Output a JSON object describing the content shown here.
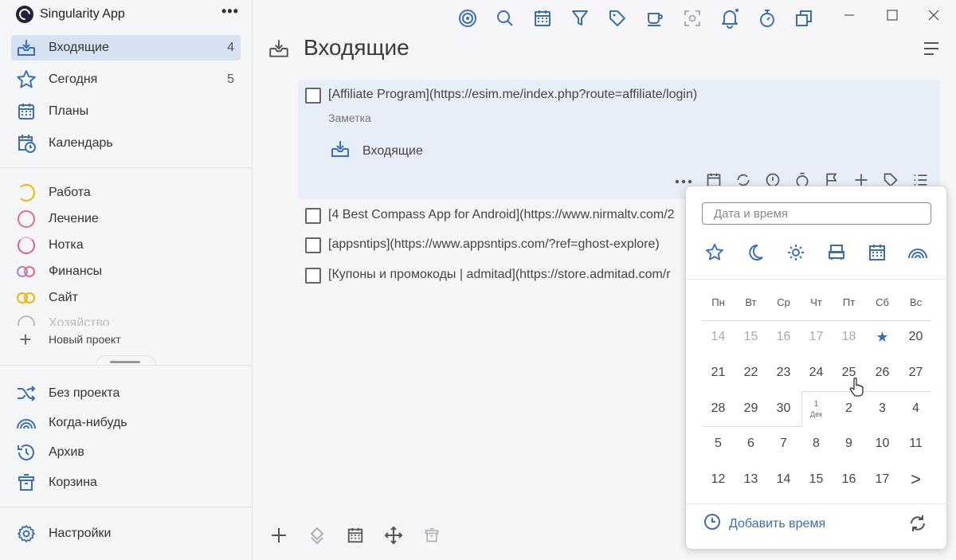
{
  "app": {
    "title": "Singularity App"
  },
  "sidebar": {
    "main_items": [
      {
        "label": "Входящие",
        "count": "4",
        "icon": "inbox-icon"
      },
      {
        "label": "Сегодня",
        "count": "5",
        "icon": "star-icon"
      },
      {
        "label": "Планы",
        "count": "",
        "icon": "calendar-icon"
      },
      {
        "label": "Календарь",
        "count": "",
        "icon": "calendar-clock-icon"
      }
    ],
    "projects": [
      {
        "label": "Работа",
        "color": "#f4b400"
      },
      {
        "label": "Лечение",
        "color": "#e86a8c"
      },
      {
        "label": "Нотка",
        "color": "#e05a8a"
      },
      {
        "label": "Финансы",
        "color": "#9b8ad8"
      },
      {
        "label": "Сайт",
        "color": "#f4b400"
      },
      {
        "label": "Хозяйство",
        "color": "#bbbbbb"
      }
    ],
    "new_project_label": "Новый проект",
    "bottom_items": [
      {
        "label": "Без проекта",
        "icon": "shuffle-icon"
      },
      {
        "label": "Когда-нибудь",
        "icon": "rainbow-icon"
      },
      {
        "label": "Архив",
        "icon": "history-icon"
      },
      {
        "label": "Корзина",
        "icon": "trash-icon"
      }
    ],
    "settings_label": "Настройки"
  },
  "main": {
    "title": "Входящие",
    "tasks": [
      {
        "text": "[Affiliate Program](https://esim.me/index.php?route=affiliate/login)",
        "note": "Заметка",
        "project": "Входящие"
      },
      {
        "text": "[4 Best Compass App for Android](https://www.nirmaltv.com/2"
      },
      {
        "text": "[appsntips](https://www.appsntips.com/?ref=ghost-explore)"
      },
      {
        "text": "[Купоны и промокоды | admitad](https://store.admitad.com/r"
      }
    ]
  },
  "date_picker": {
    "placeholder": "Дата и время",
    "weekdays": [
      "Пн",
      "Вт",
      "Ср",
      "Чт",
      "Пт",
      "Сб",
      "Вс"
    ],
    "weeks": [
      [
        "14",
        "15",
        "16",
        "17",
        "18",
        "★",
        "20"
      ],
      [
        "21",
        "22",
        "23",
        "24",
        "25",
        "26",
        "27"
      ],
      [
        "28",
        "29",
        "30",
        "1",
        "2",
        "3",
        "4"
      ],
      [
        "5",
        "6",
        "7",
        "8",
        "9",
        "10",
        "11"
      ],
      [
        "12",
        "13",
        "14",
        "15",
        "16",
        "17",
        ">"
      ]
    ],
    "month_marker": "Дек",
    "add_time_label": "Добавить время"
  },
  "colors": {
    "accent": "#3a6fb5",
    "active_bg": "#d6e1f1",
    "icon": "#3a6fb5"
  }
}
